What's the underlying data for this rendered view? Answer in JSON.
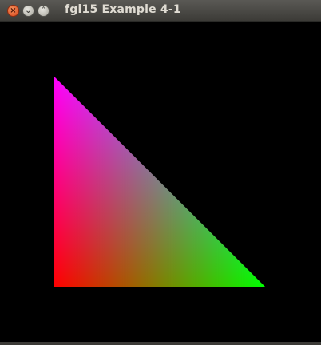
{
  "window": {
    "title": "fgl15 Example 4-1"
  },
  "controls": {
    "close_glyph": "×",
    "minimize_glyph": "⌄",
    "maximize_glyph": "˄"
  },
  "scene": {
    "background": "#000000",
    "vertex_colors": {
      "top": "#0000ff",
      "bottom_left": "#ff0000",
      "bottom_right": "#00ff00"
    }
  }
}
